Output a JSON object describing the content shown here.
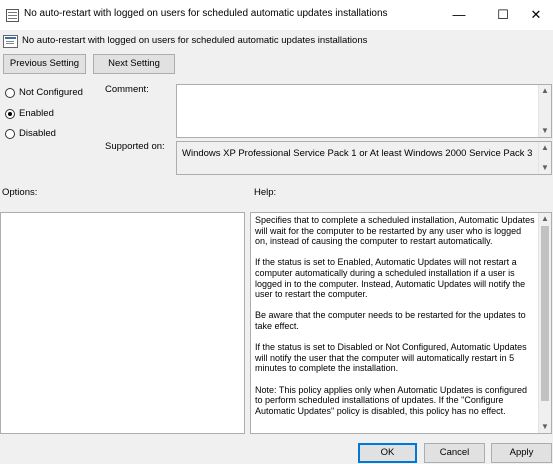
{
  "window": {
    "title": "No auto-restart with logged on users for scheduled automatic updates installations",
    "minimize_glyph": "—",
    "maximize_glyph": "☐",
    "close_glyph": "✕"
  },
  "header": {
    "title": "No auto-restart with logged on users for scheduled automatic updates installations"
  },
  "nav": {
    "previous_label": "Previous Setting",
    "next_label": "Next Setting"
  },
  "state": {
    "options": [
      {
        "label": "Not Configured",
        "checked": false
      },
      {
        "label": "Enabled",
        "checked": true
      },
      {
        "label": "Disabled",
        "checked": false
      }
    ]
  },
  "comment": {
    "label": "Comment:",
    "value": ""
  },
  "supported": {
    "label": "Supported on:",
    "value": "Windows XP Professional Service Pack 1 or At least Windows 2000 Service Pack 3"
  },
  "options_panel": {
    "label": "Options:"
  },
  "help": {
    "label": "Help:",
    "paragraphs": [
      "Specifies that to complete a scheduled installation, Automatic Updates will wait for the computer to be restarted by any user who is logged on, instead of causing the computer to restart automatically.",
      "If the status is set to Enabled, Automatic Updates will not restart a computer automatically during a scheduled installation if a user is logged in to the computer. Instead, Automatic Updates will notify the user to restart the computer.",
      "Be aware that the computer needs to be restarted for the updates to take effect.",
      "If the status is set to Disabled or Not Configured, Automatic Updates will notify the user that the computer will automatically restart in 5 minutes to complete the installation.",
      "Note: This policy applies only when Automatic Updates is configured to perform scheduled installations of updates. If the \"Configure Automatic Updates\" policy is disabled, this policy has no effect."
    ]
  },
  "footer": {
    "ok_label": "OK",
    "cancel_label": "Cancel",
    "apply_label": "Apply"
  },
  "icons": {
    "scroll_up": "▲",
    "scroll_down": "▼"
  },
  "colors": {
    "background": "#f0f0f0",
    "default_button_border": "#0078d7"
  }
}
